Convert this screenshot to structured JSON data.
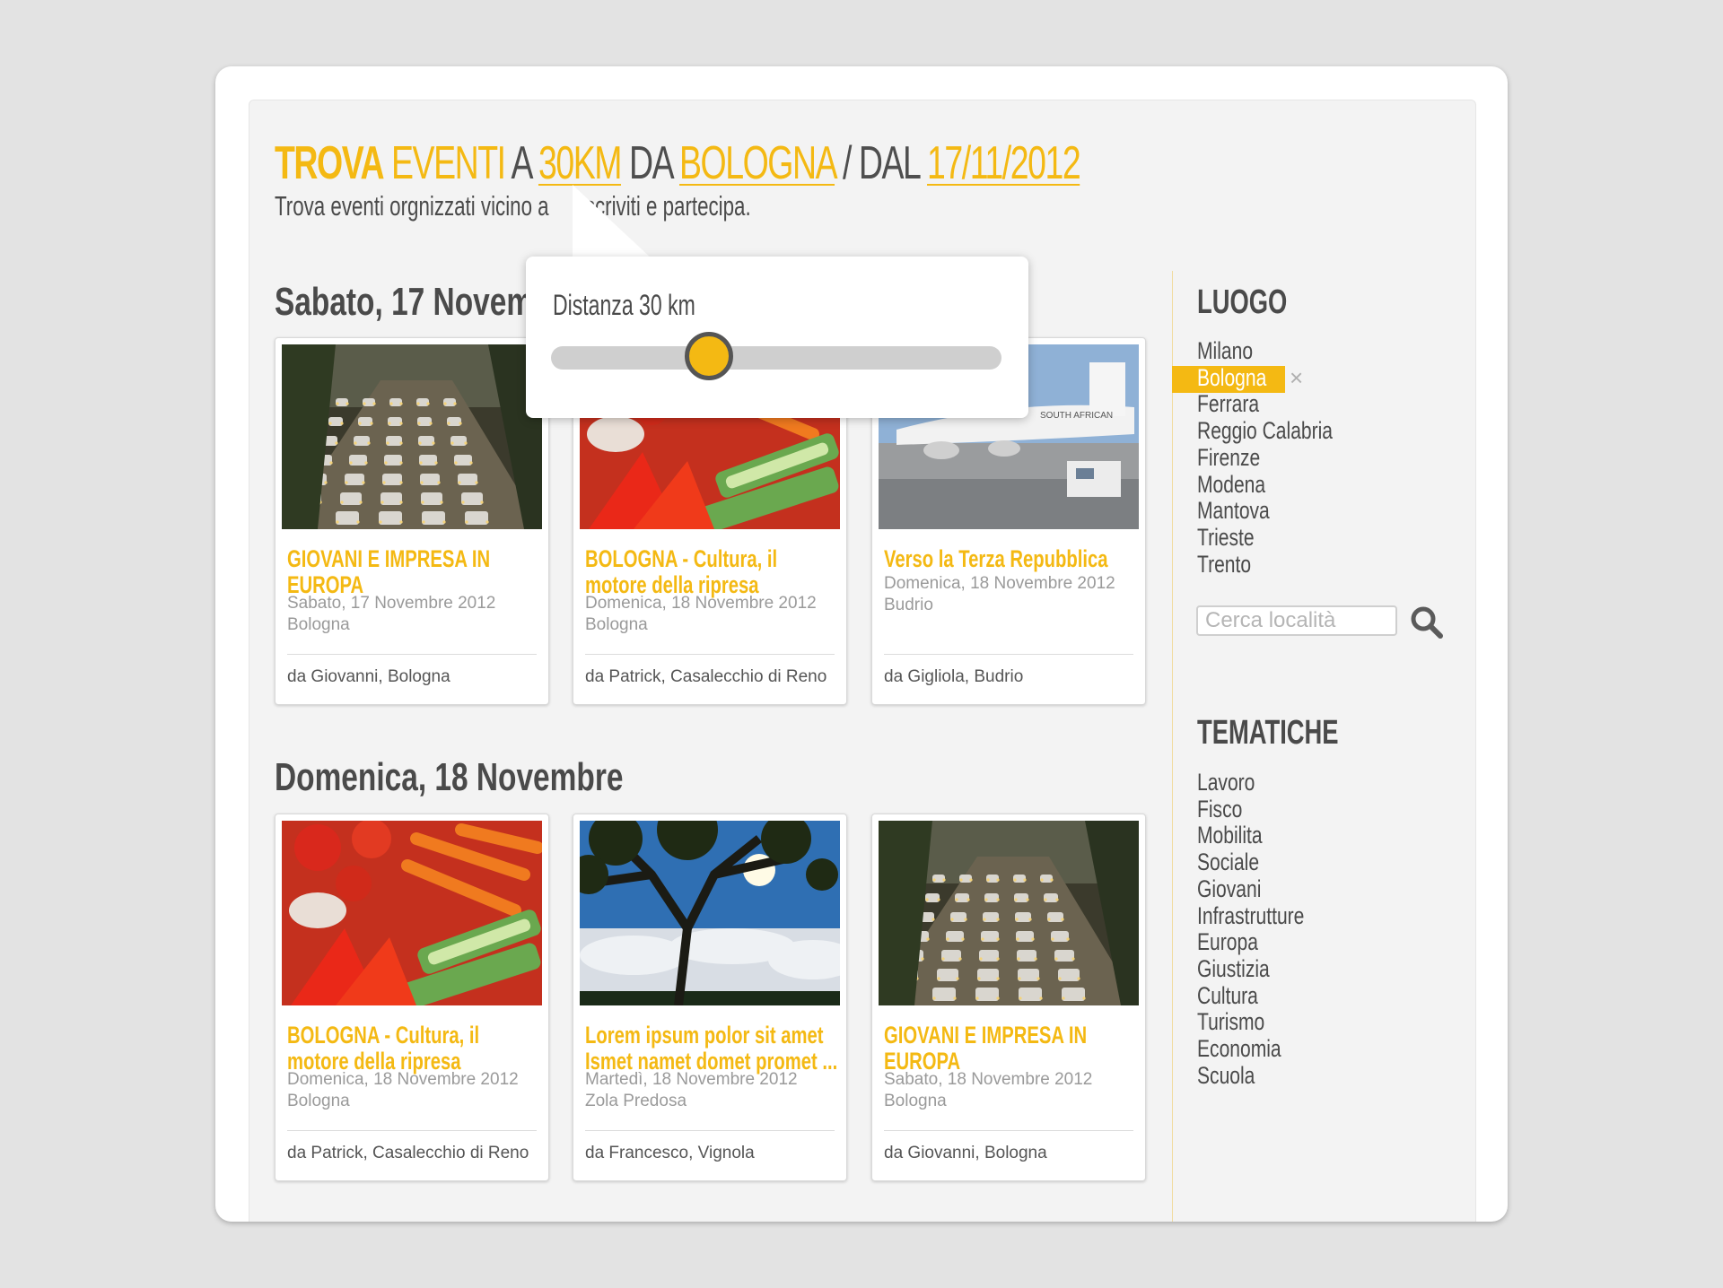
{
  "header": {
    "trova": "TROVA",
    "eventi": "EVENTI",
    "a": "A",
    "distance": "30KM",
    "da": "DA",
    "city": "BOLOGNA",
    "dal": "/ DAL",
    "date": "17/11/2012",
    "subtitle_left": "Trova eventi orgnizzati vicino a",
    "subtitle_right": "Iscriviti e partecipa."
  },
  "distance_popover": {
    "label": "Distanza 30 km",
    "slider_value_fraction": 0.33
  },
  "days": [
    {
      "title": "Sabato, 17 Novembre",
      "events": [
        {
          "title": "GIOVANI E IMPRESA IN EUROPA",
          "date": "Sabato, 17 Novembre 2012",
          "place": "Bologna",
          "by": "da Giovanni, Bologna",
          "image": "traffic-photo"
        },
        {
          "title": "BOLOGNA - Cultura, il motore della ripresa",
          "date": "Domenica, 18 Novembre 2012",
          "place": "Bologna",
          "by": "da Patrick, Casalecchio di Reno",
          "image": "vegetables-photo"
        },
        {
          "title": "Verso la Terza Repubblica",
          "date": "Domenica, 18 Novembre 2012",
          "place": "Budrio",
          "by": "da Gigliola, Budrio",
          "image": "airplane-photo"
        }
      ]
    },
    {
      "title": "Domenica, 18 Novembre",
      "events": [
        {
          "title": "BOLOGNA - Cultura, il motore della ripresa",
          "date": "Domenica, 18 Novembre 2012",
          "place": "Bologna",
          "by": "da Patrick, Casalecchio di Reno",
          "image": "vegetables-photo"
        },
        {
          "title": "Lorem ipsum polor sit amet Ismet namet domet promet ...",
          "date": "Martedì, 18 Novembre 2012",
          "place": "Zola Predosa",
          "by": "da Francesco, Vignola",
          "image": "tree-sky-photo"
        },
        {
          "title": "GIOVANI E IMPRESA IN EUROPA",
          "date": "Sabato, 18 Novembre 2012",
          "place": "Bologna",
          "by": "da Giovanni, Bologna",
          "image": "traffic-photo"
        }
      ]
    }
  ],
  "sidebar": {
    "luogo_title": "LUOGO",
    "places": [
      "Milano",
      "Bologna",
      "Ferrara",
      "Reggio Calabria",
      "Firenze",
      "Modena",
      "Mantova",
      "Trieste",
      "Trento"
    ],
    "selected_place": "Bologna",
    "remove_symbol": "×",
    "search_placeholder": "Cerca località",
    "tematiche_title": "TEMATICHE",
    "topics": [
      "Lavoro",
      "Fisco",
      "Mobilita",
      "Sociale",
      "Giovani",
      "Infrastrutture",
      "Europa",
      "Giustizia",
      "Cultura",
      "Turismo",
      "Economia",
      "Scuola"
    ]
  },
  "colors": {
    "accent": "#f4b913",
    "text": "#4a4a4a",
    "muted": "#9a9a9a",
    "page_bg": "#e3e3e3"
  }
}
